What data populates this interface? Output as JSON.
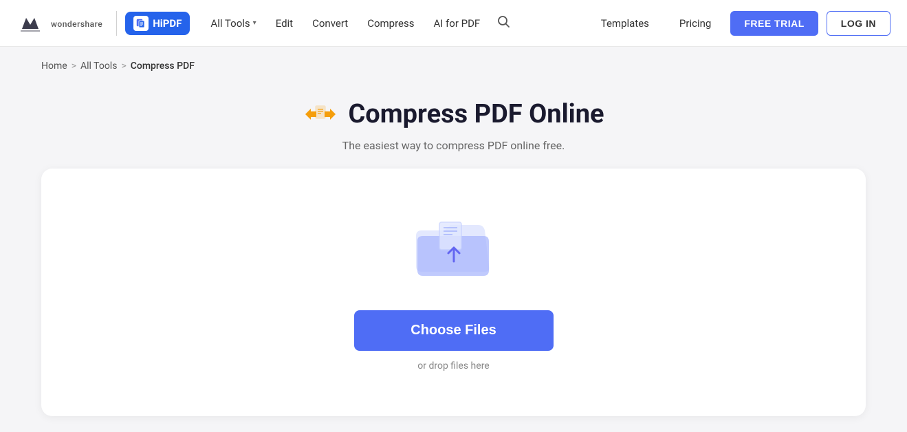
{
  "header": {
    "brand": "wondershare",
    "hipdf_label": "HiPDF",
    "nav": {
      "all_tools_label": "All Tools",
      "edit_label": "Edit",
      "convert_label": "Convert",
      "compress_label": "Compress",
      "ai_for_pdf_label": "AI for PDF",
      "templates_label": "Templates",
      "pricing_label": "Pricing",
      "free_trial_label": "FREE TRIAL",
      "login_label": "LOG IN"
    }
  },
  "breadcrumb": {
    "home": "Home",
    "all_tools": "All Tools",
    "current": "Compress PDF",
    "sep1": ">",
    "sep2": ">"
  },
  "page": {
    "title": "Compress PDF Online",
    "subtitle": "The easiest way to compress PDF online free."
  },
  "dropzone": {
    "choose_files_label": "Choose Files",
    "drop_hint": "or drop files here"
  }
}
